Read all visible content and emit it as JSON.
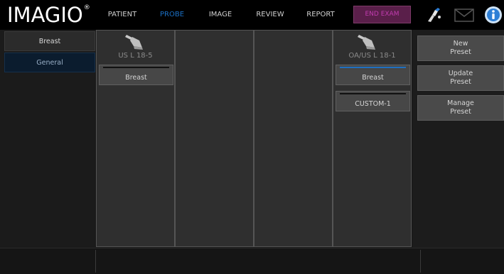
{
  "app": {
    "logo_text": "IMAGIO",
    "logo_mark": "®"
  },
  "nav": {
    "items": [
      {
        "label": "PATIENT"
      },
      {
        "label": "PROBE"
      },
      {
        "label": "IMAGE"
      },
      {
        "label": "REVIEW"
      },
      {
        "label": "REPORT"
      }
    ],
    "active": "PROBE",
    "end_exam": "END EXAM",
    "icons": [
      "probe-hand-icon",
      "mail-icon",
      "info-icon"
    ]
  },
  "left_panel": {
    "items": [
      {
        "label": "Breast",
        "selected": false
      },
      {
        "label": "General",
        "selected": true
      }
    ]
  },
  "probes": [
    {
      "name": "US L 18-5",
      "presets": [
        {
          "label": "Breast",
          "active": false
        }
      ]
    },
    {
      "name": "",
      "presets": []
    },
    {
      "name": "",
      "presets": []
    },
    {
      "name": "OA/US L 18-1",
      "presets": [
        {
          "label": "Breast",
          "active": true
        },
        {
          "label": "CUSTOM-1",
          "active": false
        }
      ]
    }
  ],
  "right_panel": {
    "new_preset": "New\nPreset",
    "update_preset": "Update\nPreset",
    "manage_preset": "Manage\nPreset"
  },
  "colors": {
    "accent_blue": "#1f6fc0",
    "end_exam_bg": "#5a1f4a",
    "end_exam_text": "#c23cb0",
    "selected_bg": "#0b1c2e"
  }
}
